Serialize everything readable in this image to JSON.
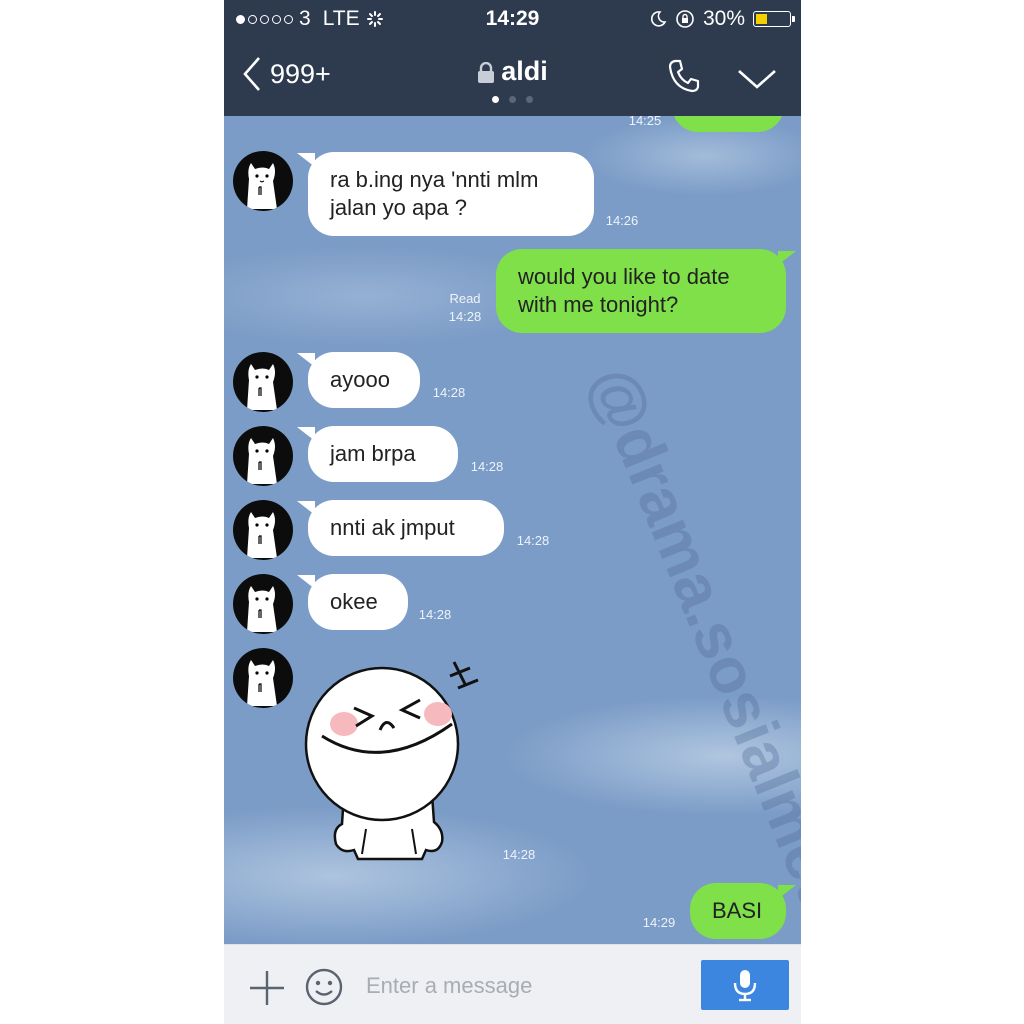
{
  "status": {
    "carrier": "3",
    "network": "LTE",
    "time": "14:29",
    "battery": "30%"
  },
  "header": {
    "back_count": "999+",
    "title": "aldi"
  },
  "watermark": "@drama.sosialmedia",
  "messages": {
    "top_time": "14:25",
    "m1": {
      "text_line1": "ra b.ing nya 'nnti mlm",
      "text_line2": "jalan yo apa ?",
      "time": "14:26"
    },
    "m2": {
      "text_line1": "would you like to date",
      "text_line2": "with me tonight?",
      "read": "Read",
      "time": "14:28"
    },
    "m3": {
      "text": "ayooo",
      "time": "14:28"
    },
    "m4": {
      "text": "jam brpa",
      "time": "14:28"
    },
    "m5": {
      "text": "nnti ak jmput",
      "time": "14:28"
    },
    "m6": {
      "text": "okee",
      "time": "14:28"
    },
    "sticker": {
      "time": "14:28"
    },
    "m7": {
      "text": "BASI",
      "time": "14:29"
    }
  },
  "input": {
    "placeholder": "Enter a message"
  },
  "colors": {
    "bar": "#2e3b4f",
    "chat_bg": "#7b9cc7",
    "outgoing": "#7fe04a",
    "incoming": "#ffffff",
    "mic": "#3d86e0"
  }
}
